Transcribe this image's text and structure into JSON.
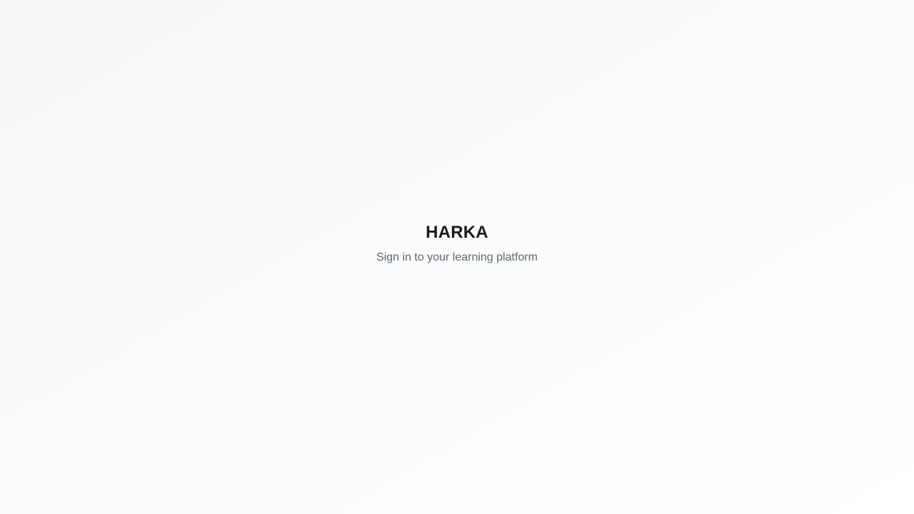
{
  "login": {
    "title": "HARKA",
    "subtitle": "Sign in to your learning platform"
  }
}
